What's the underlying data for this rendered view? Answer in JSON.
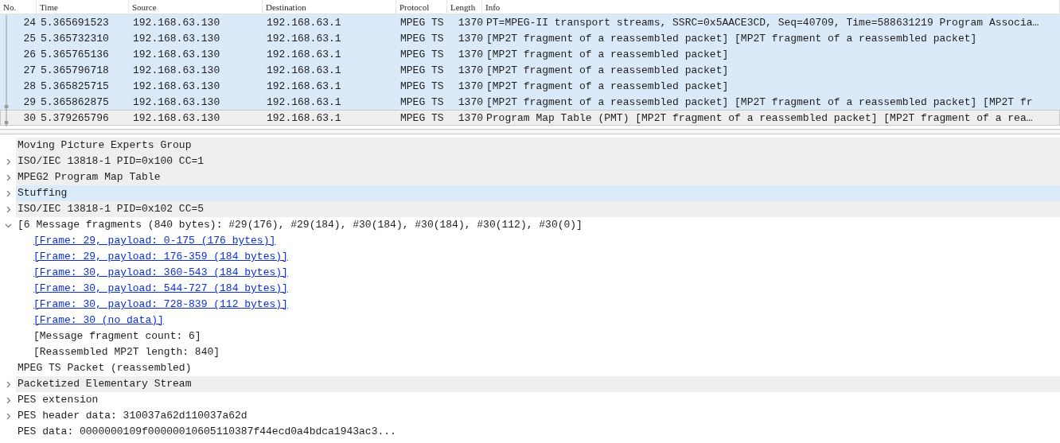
{
  "packet_list": {
    "columns": [
      "No.",
      "Time",
      "Source",
      "Destination",
      "Protocol",
      "Length",
      "Info"
    ],
    "rows": [
      {
        "no": "24",
        "time": "5.365691523",
        "source": "192.168.63.130",
        "destination": "192.168.63.1",
        "protocol": "MPEG TS",
        "length": "1370",
        "info": "PT=MPEG-II transport streams, SSRC=0x5AACE3CD, Seq=40709, Time=588631219 Program Associa…",
        "selected": false,
        "color": "#daeaf9",
        "related_dot": false
      },
      {
        "no": "25",
        "time": "5.365732310",
        "source": "192.168.63.130",
        "destination": "192.168.63.1",
        "protocol": "MPEG TS",
        "length": "1370",
        "info": "[MP2T fragment of a reassembled packet] [MP2T fragment of a reassembled packet]",
        "selected": false,
        "color": "#daeaf9",
        "related_dot": false
      },
      {
        "no": "26",
        "time": "5.365765136",
        "source": "192.168.63.130",
        "destination": "192.168.63.1",
        "protocol": "MPEG TS",
        "length": "1370",
        "info": "[MP2T fragment of a reassembled packet]",
        "selected": false,
        "color": "#daeaf9",
        "related_dot": false
      },
      {
        "no": "27",
        "time": "5.365796718",
        "source": "192.168.63.130",
        "destination": "192.168.63.1",
        "protocol": "MPEG TS",
        "length": "1370",
        "info": "[MP2T fragment of a reassembled packet]",
        "selected": false,
        "color": "#daeaf9",
        "related_dot": false
      },
      {
        "no": "28",
        "time": "5.365825715",
        "source": "192.168.63.130",
        "destination": "192.168.63.1",
        "protocol": "MPEG TS",
        "length": "1370",
        "info": "[MP2T fragment of a reassembled packet]",
        "selected": false,
        "color": "#daeaf9",
        "related_dot": false
      },
      {
        "no": "29",
        "time": "5.365862875",
        "source": "192.168.63.130",
        "destination": "192.168.63.1",
        "protocol": "MPEG TS",
        "length": "1370",
        "info": "[MP2T fragment of a reassembled packet] [MP2T fragment of a reassembled packet] [MP2T fr",
        "selected": false,
        "color": "#daeaf9",
        "related_dot": true
      },
      {
        "no": "30",
        "time": "5.379265796",
        "source": "192.168.63.130",
        "destination": "192.168.63.1",
        "protocol": "MPEG TS",
        "length": "1370",
        "info": "Program Map Table (PMT) [MP2T fragment of a reassembled packet] [MP2T fragment of a rea…",
        "selected": true,
        "related_dot": true
      }
    ]
  },
  "detail_tree": [
    {
      "text": "Moving Picture Experts Group",
      "selected": false,
      "shaded": true
    },
    {
      "text": "ISO/IEC 13818-1 PID=0x100 CC=1",
      "expanded": false,
      "selected": false,
      "shaded": true
    },
    {
      "text": "MPEG2 Program Map Table",
      "expanded": false,
      "selected": false,
      "shaded": true
    },
    {
      "text": "Stuffing",
      "expanded": false,
      "selected": true
    },
    {
      "text": "ISO/IEC 13818-1 PID=0x102 CC=5",
      "expanded": false,
      "selected": false,
      "shaded": true
    },
    {
      "text": "[6 Message fragments (840 bytes): #29(176), #29(184), #30(184), #30(184), #30(112), #30(0)]",
      "expanded": true,
      "selected": false,
      "shaded": false,
      "children": [
        {
          "kind": "link",
          "text": "[Frame: 29, payload: 0-175 (176 bytes)]"
        },
        {
          "kind": "link",
          "text": "[Frame: 29, payload: 176-359 (184 bytes)]"
        },
        {
          "kind": "link",
          "text": "[Frame: 30, payload: 360-543 (184 bytes)]"
        },
        {
          "kind": "link",
          "text": "[Frame: 30, payload: 544-727 (184 bytes)]"
        },
        {
          "kind": "link",
          "text": "[Frame: 30, payload: 728-839 (112 bytes)]"
        },
        {
          "kind": "link",
          "text": "[Frame: 30 (no data)]"
        },
        {
          "kind": "text",
          "text": "[Message fragment count: 6]"
        },
        {
          "kind": "text",
          "text": "[Reassembled MP2T length: 840]"
        }
      ]
    },
    {
      "text": "MPEG TS Packet (reassembled)",
      "selected": false,
      "shaded": false
    },
    {
      "text": "Packetized Elementary Stream",
      "expanded": false,
      "selected": false,
      "shaded": true
    },
    {
      "text": "PES extension",
      "expanded": false,
      "selected": false,
      "shaded": false
    },
    {
      "text": "PES header data: 310037a62d110037a62d",
      "expanded": false,
      "selected": false,
      "shaded": false
    },
    {
      "text": "PES data: 0000000109f00000010605110387f44ecd0a4bdca1943ac3...",
      "selected": false,
      "shaded": false
    }
  ]
}
